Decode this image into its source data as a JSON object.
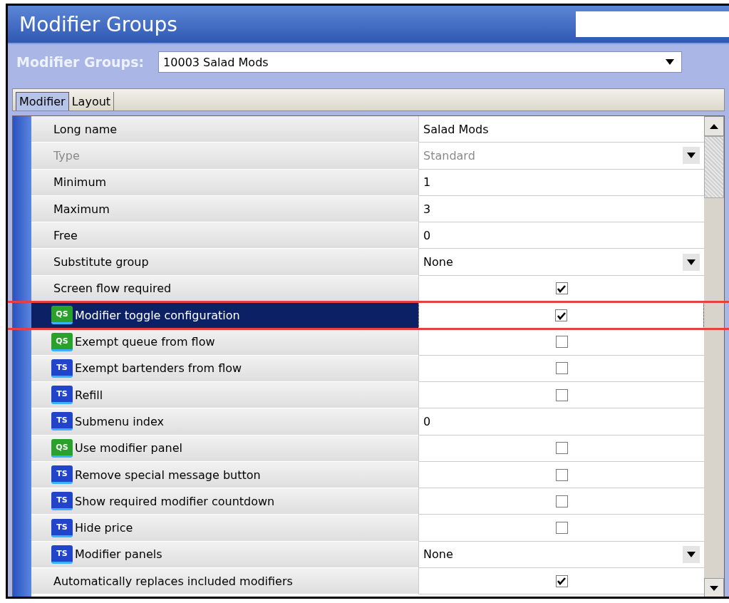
{
  "window": {
    "title": "Modifier Groups"
  },
  "selector": {
    "label": "Modifier Groups:",
    "value": "10003 Salad Mods"
  },
  "tabs": [
    {
      "label": "Modifier",
      "selected": true
    },
    {
      "label": "Layout",
      "selected": false
    }
  ],
  "rows": [
    {
      "label": "Long name",
      "kind": "text",
      "value": "Salad Mods",
      "disabled": false,
      "selected": false
    },
    {
      "label": "Type",
      "kind": "dropdown",
      "value": "Standard",
      "disabled": true,
      "selected": false
    },
    {
      "label": "Minimum",
      "kind": "text",
      "value": "1",
      "disabled": false,
      "selected": false
    },
    {
      "label": "Maximum",
      "kind": "text",
      "value": "3",
      "disabled": false,
      "selected": false
    },
    {
      "label": "Free",
      "kind": "text",
      "value": "0",
      "disabled": false,
      "selected": false
    },
    {
      "label": "Substitute group",
      "kind": "dropdown",
      "value": "None",
      "disabled": false,
      "selected": false
    },
    {
      "label": "Screen flow required",
      "kind": "checkbox",
      "checked": true,
      "disabled": false,
      "selected": false
    },
    {
      "label": "Modifier toggle configuration",
      "kind": "checkbox",
      "checked": true,
      "disabled": false,
      "selected": true,
      "icon": {
        "kind": "qs",
        "label": "QS"
      }
    },
    {
      "label": "Exempt queue from flow",
      "kind": "checkbox",
      "checked": false,
      "disabled": false,
      "selected": false,
      "icon": {
        "kind": "qs",
        "label": "QS"
      }
    },
    {
      "label": "Exempt bartenders from flow",
      "kind": "checkbox",
      "checked": false,
      "disabled": false,
      "selected": false,
      "icon": {
        "kind": "ts",
        "label": "TS"
      }
    },
    {
      "label": "Refill",
      "kind": "checkbox",
      "checked": false,
      "disabled": false,
      "selected": false,
      "icon": {
        "kind": "ts",
        "label": "TS"
      }
    },
    {
      "label": "Submenu index",
      "kind": "text",
      "value": "0",
      "disabled": false,
      "selected": false,
      "icon": {
        "kind": "ts",
        "label": "TS"
      }
    },
    {
      "label": "Use modifier panel",
      "kind": "checkbox",
      "checked": false,
      "disabled": false,
      "selected": false,
      "icon": {
        "kind": "qs",
        "label": "QS"
      }
    },
    {
      "label": "Remove special message button",
      "kind": "checkbox",
      "checked": false,
      "disabled": false,
      "selected": false,
      "icon": {
        "kind": "ts",
        "label": "TS"
      }
    },
    {
      "label": "Show required modifier countdown",
      "kind": "checkbox",
      "checked": false,
      "disabled": false,
      "selected": false,
      "icon": {
        "kind": "ts",
        "label": "TS"
      }
    },
    {
      "label": "Hide price",
      "kind": "checkbox",
      "checked": false,
      "disabled": false,
      "selected": false,
      "icon": {
        "kind": "ts",
        "label": "TS"
      }
    },
    {
      "label": "Modifier panels",
      "kind": "dropdown",
      "value": "None",
      "disabled": false,
      "selected": false,
      "icon": {
        "kind": "ts",
        "label": "TS"
      }
    },
    {
      "label": "Automatically replaces included modifiers",
      "kind": "checkbox",
      "checked": true,
      "disabled": false,
      "selected": false
    }
  ]
}
